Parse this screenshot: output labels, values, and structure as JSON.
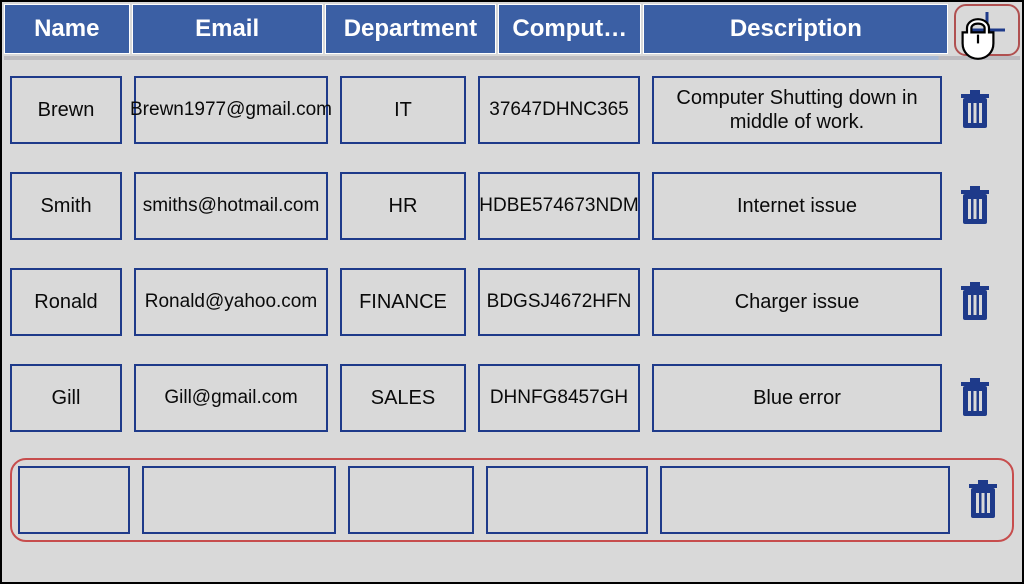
{
  "headers": {
    "name": "Name",
    "email": "Email",
    "department": "Department",
    "computer": "Comput…",
    "description": "Description"
  },
  "rows": [
    {
      "name": "Brewn",
      "email": "Brewn1977@gmail.com",
      "department": "IT",
      "computer": "37647DHNC365",
      "description": "Computer Shutting down in middle of work."
    },
    {
      "name": "Smith",
      "email": "smiths@hotmail.com",
      "department": "HR",
      "computer": "HDBE574673NDM",
      "description": "Internet issue"
    },
    {
      "name": "Ronald",
      "email": "Ronald@yahoo.com",
      "department": "FINANCE",
      "computer": "BDGSJ4672HFN",
      "description": "Charger issue"
    },
    {
      "name": "Gill",
      "email": "Gill@gmail.com",
      "department": "SALES",
      "computer": "DHNFG8457GH",
      "description": "Blue error"
    },
    {
      "name": "",
      "email": "",
      "department": "",
      "computer": "",
      "description": ""
    }
  ],
  "colors": {
    "headerBg": "#3b5fa4",
    "cellBorder": "#1e3a8a",
    "highlight": "#c74d4d"
  }
}
